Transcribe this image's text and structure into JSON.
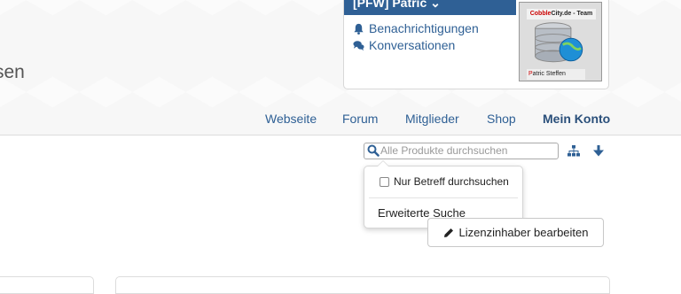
{
  "header": {
    "site_title_fragment": "sen"
  },
  "user_panel": {
    "username": "[PFW] Patric",
    "links": [
      {
        "label": "Benachrichtigungen",
        "icon": "bell-icon"
      },
      {
        "label": "Konversationen",
        "icon": "comments-icon"
      }
    ],
    "avatar": {
      "banner_prefix": "Cobble",
      "banner_rest": "City.de - Team",
      "name_first_letter": "P",
      "name_rest": "atric Steffen"
    }
  },
  "nav": {
    "tabs": [
      "Webseite",
      "Forum",
      "Mitglieder",
      "Shop",
      "Mein Konto"
    ],
    "active": "Mein Konto"
  },
  "search": {
    "placeholder": "Alle Produkte durchsuchen",
    "options": {
      "title_only_label": "Nur Betreff durchsuchen",
      "title_only_checked": false,
      "advanced_label": "Erweiterte Suche"
    }
  },
  "actions": {
    "edit_label": "Lizenzinhaber bearbeiten"
  },
  "colors": {
    "accent": "#2f6095",
    "active_tab": "#2a4f7a"
  }
}
